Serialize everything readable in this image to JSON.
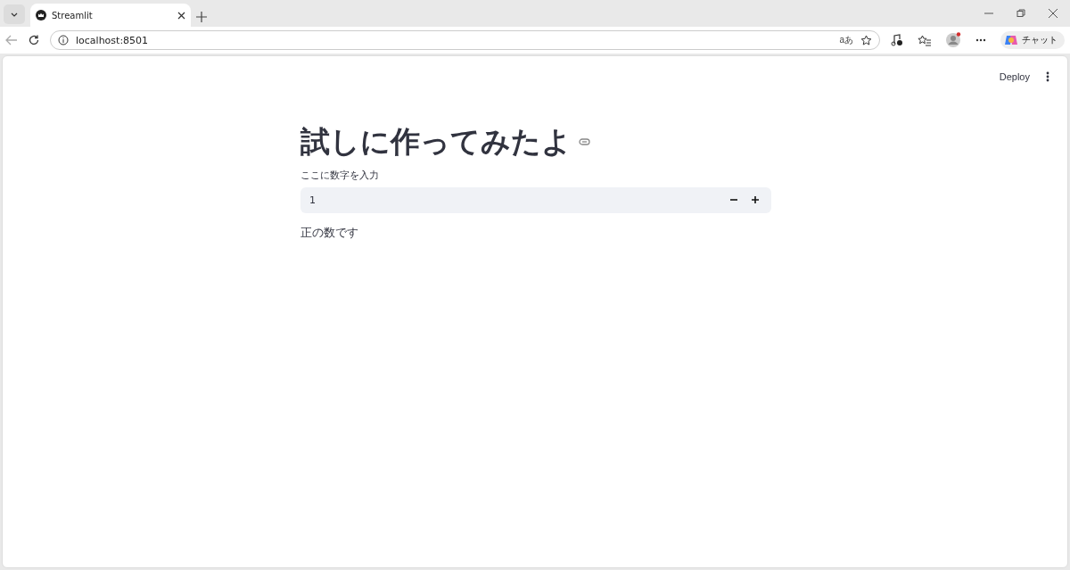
{
  "browser": {
    "tab": {
      "title": "Streamlit",
      "selected": true
    },
    "address": "localhost:8501",
    "translate": "aあ",
    "copilot_label": "チャット"
  },
  "toolbar": {
    "deploy": "Deploy"
  },
  "title": "試しに作ってみたよ",
  "number_input": {
    "label": "ここに数字を入力",
    "value": "1"
  },
  "message": "正の数です"
}
